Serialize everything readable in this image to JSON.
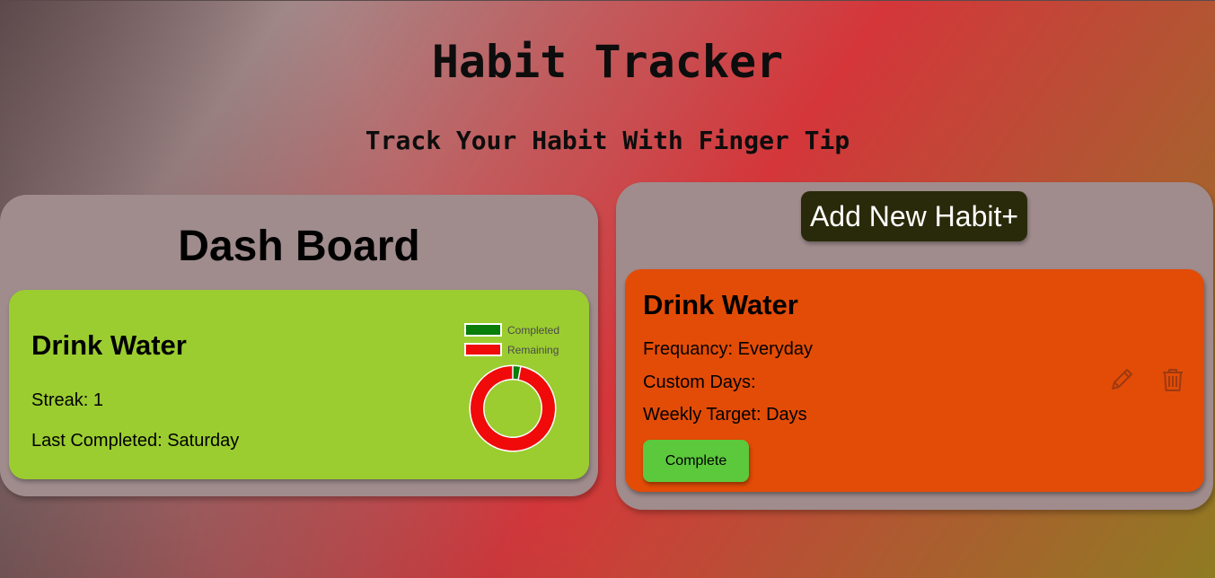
{
  "header": {
    "title": "Habit Tracker",
    "subtitle": "Track Your Habit With Finger Tip"
  },
  "dashboard": {
    "title": "Dash Board",
    "card": {
      "habit_name": "Drink Water",
      "streak_text": "Streak: 1",
      "last_completed_text": "Last Completed: Saturday",
      "legend": [
        {
          "label": "Completed",
          "color": "#0a7d0a"
        },
        {
          "label": "Remaining",
          "color": "#f00a0a"
        }
      ],
      "progress": {
        "completed_fraction": 0.03
      }
    }
  },
  "habits_panel": {
    "add_button_label": "Add New Habit+",
    "card": {
      "habit_name": "Drink Water",
      "frequency_text": "Frequancy: Everyday",
      "custom_days_text": "Custom Days:",
      "weekly_target_text": "Weekly Target: Days",
      "complete_button_label": "Complete",
      "edit_icon": "pencil-icon",
      "delete_icon": "trash-icon",
      "icon_color": "#9c3a12"
    }
  },
  "colors": {
    "dash_card": "#9bcd30",
    "habit_card": "#e34c06",
    "panel": "#a08c8d",
    "add_button": "#292a0a",
    "complete_button": "#5cc83c"
  }
}
